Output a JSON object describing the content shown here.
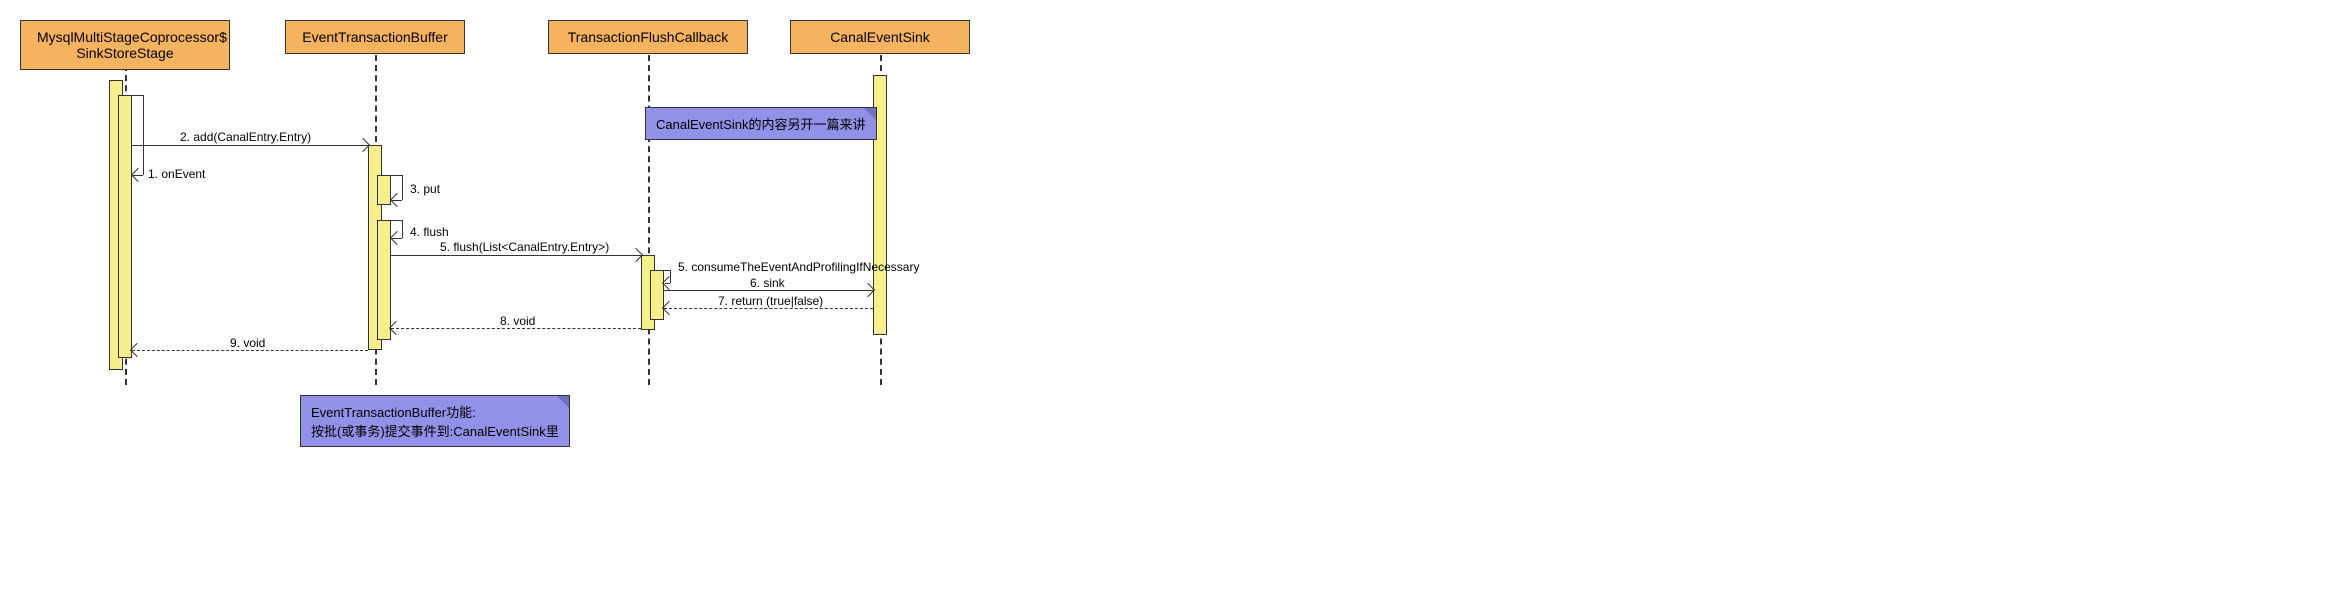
{
  "participants": {
    "p1": "MysqlMultiStageCoprocessor$\nSinkStoreStage",
    "p2": "EventTransactionBuffer",
    "p3": "TransactionFlushCallback",
    "p4": "CanalEventSink"
  },
  "messages": {
    "m1": "1. onEvent",
    "m2": "2. add(CanalEntry.Entry)",
    "m3": "3. put",
    "m4": "4. flush",
    "m5": "5. flush(List<CanalEntry.Entry>)",
    "m5b": "5. consumeTheEventAndProfilingIfNecessary",
    "m6": "6. sink",
    "m7": "7. return (true|false)",
    "m8": "8. void",
    "m9": "9. void"
  },
  "notes": {
    "n1": "CanalEventSink的内容另开一篇来讲",
    "n2_line1": "EventTransactionBuffer功能:",
    "n2_line2": "按批(或事务)提交事件到:CanalEventSink里"
  },
  "chart_data": {
    "type": "sequence-diagram",
    "participants": [
      "MysqlMultiStageCoprocessor$SinkStoreStage",
      "EventTransactionBuffer",
      "TransactionFlushCallback",
      "CanalEventSink"
    ],
    "messages": [
      {
        "from": "MysqlMultiStageCoprocessor$SinkStoreStage",
        "to": "MysqlMultiStageCoprocessor$SinkStoreStage",
        "label": "1. onEvent",
        "type": "self"
      },
      {
        "from": "MysqlMultiStageCoprocessor$SinkStoreStage",
        "to": "EventTransactionBuffer",
        "label": "2. add(CanalEntry.Entry)",
        "type": "call"
      },
      {
        "from": "EventTransactionBuffer",
        "to": "EventTransactionBuffer",
        "label": "3. put",
        "type": "self"
      },
      {
        "from": "EventTransactionBuffer",
        "to": "EventTransactionBuffer",
        "label": "4. flush",
        "type": "self"
      },
      {
        "from": "EventTransactionBuffer",
        "to": "TransactionFlushCallback",
        "label": "5. flush(List<CanalEntry.Entry>)",
        "type": "call"
      },
      {
        "from": "TransactionFlushCallback",
        "to": "CanalEventSink",
        "label": "5. consumeTheEventAndProfilingIfNecessary",
        "type": "call"
      },
      {
        "from": "TransactionFlushCallback",
        "to": "CanalEventSink",
        "label": "6. sink",
        "type": "call"
      },
      {
        "from": "CanalEventSink",
        "to": "TransactionFlushCallback",
        "label": "7. return (true|false)",
        "type": "return"
      },
      {
        "from": "TransactionFlushCallback",
        "to": "EventTransactionBuffer",
        "label": "8. void",
        "type": "return"
      },
      {
        "from": "EventTransactionBuffer",
        "to": "MysqlMultiStageCoprocessor$SinkStoreStage",
        "label": "9. void",
        "type": "return"
      }
    ],
    "notes": [
      {
        "text": "CanalEventSink的内容另开一篇来讲",
        "attached_to": "TransactionFlushCallback",
        "position": "right"
      },
      {
        "text": "EventTransactionBuffer功能:\n按批(或事务)提交事件到:CanalEventSink里",
        "attached_to": "EventTransactionBuffer",
        "position": "below"
      }
    ]
  }
}
